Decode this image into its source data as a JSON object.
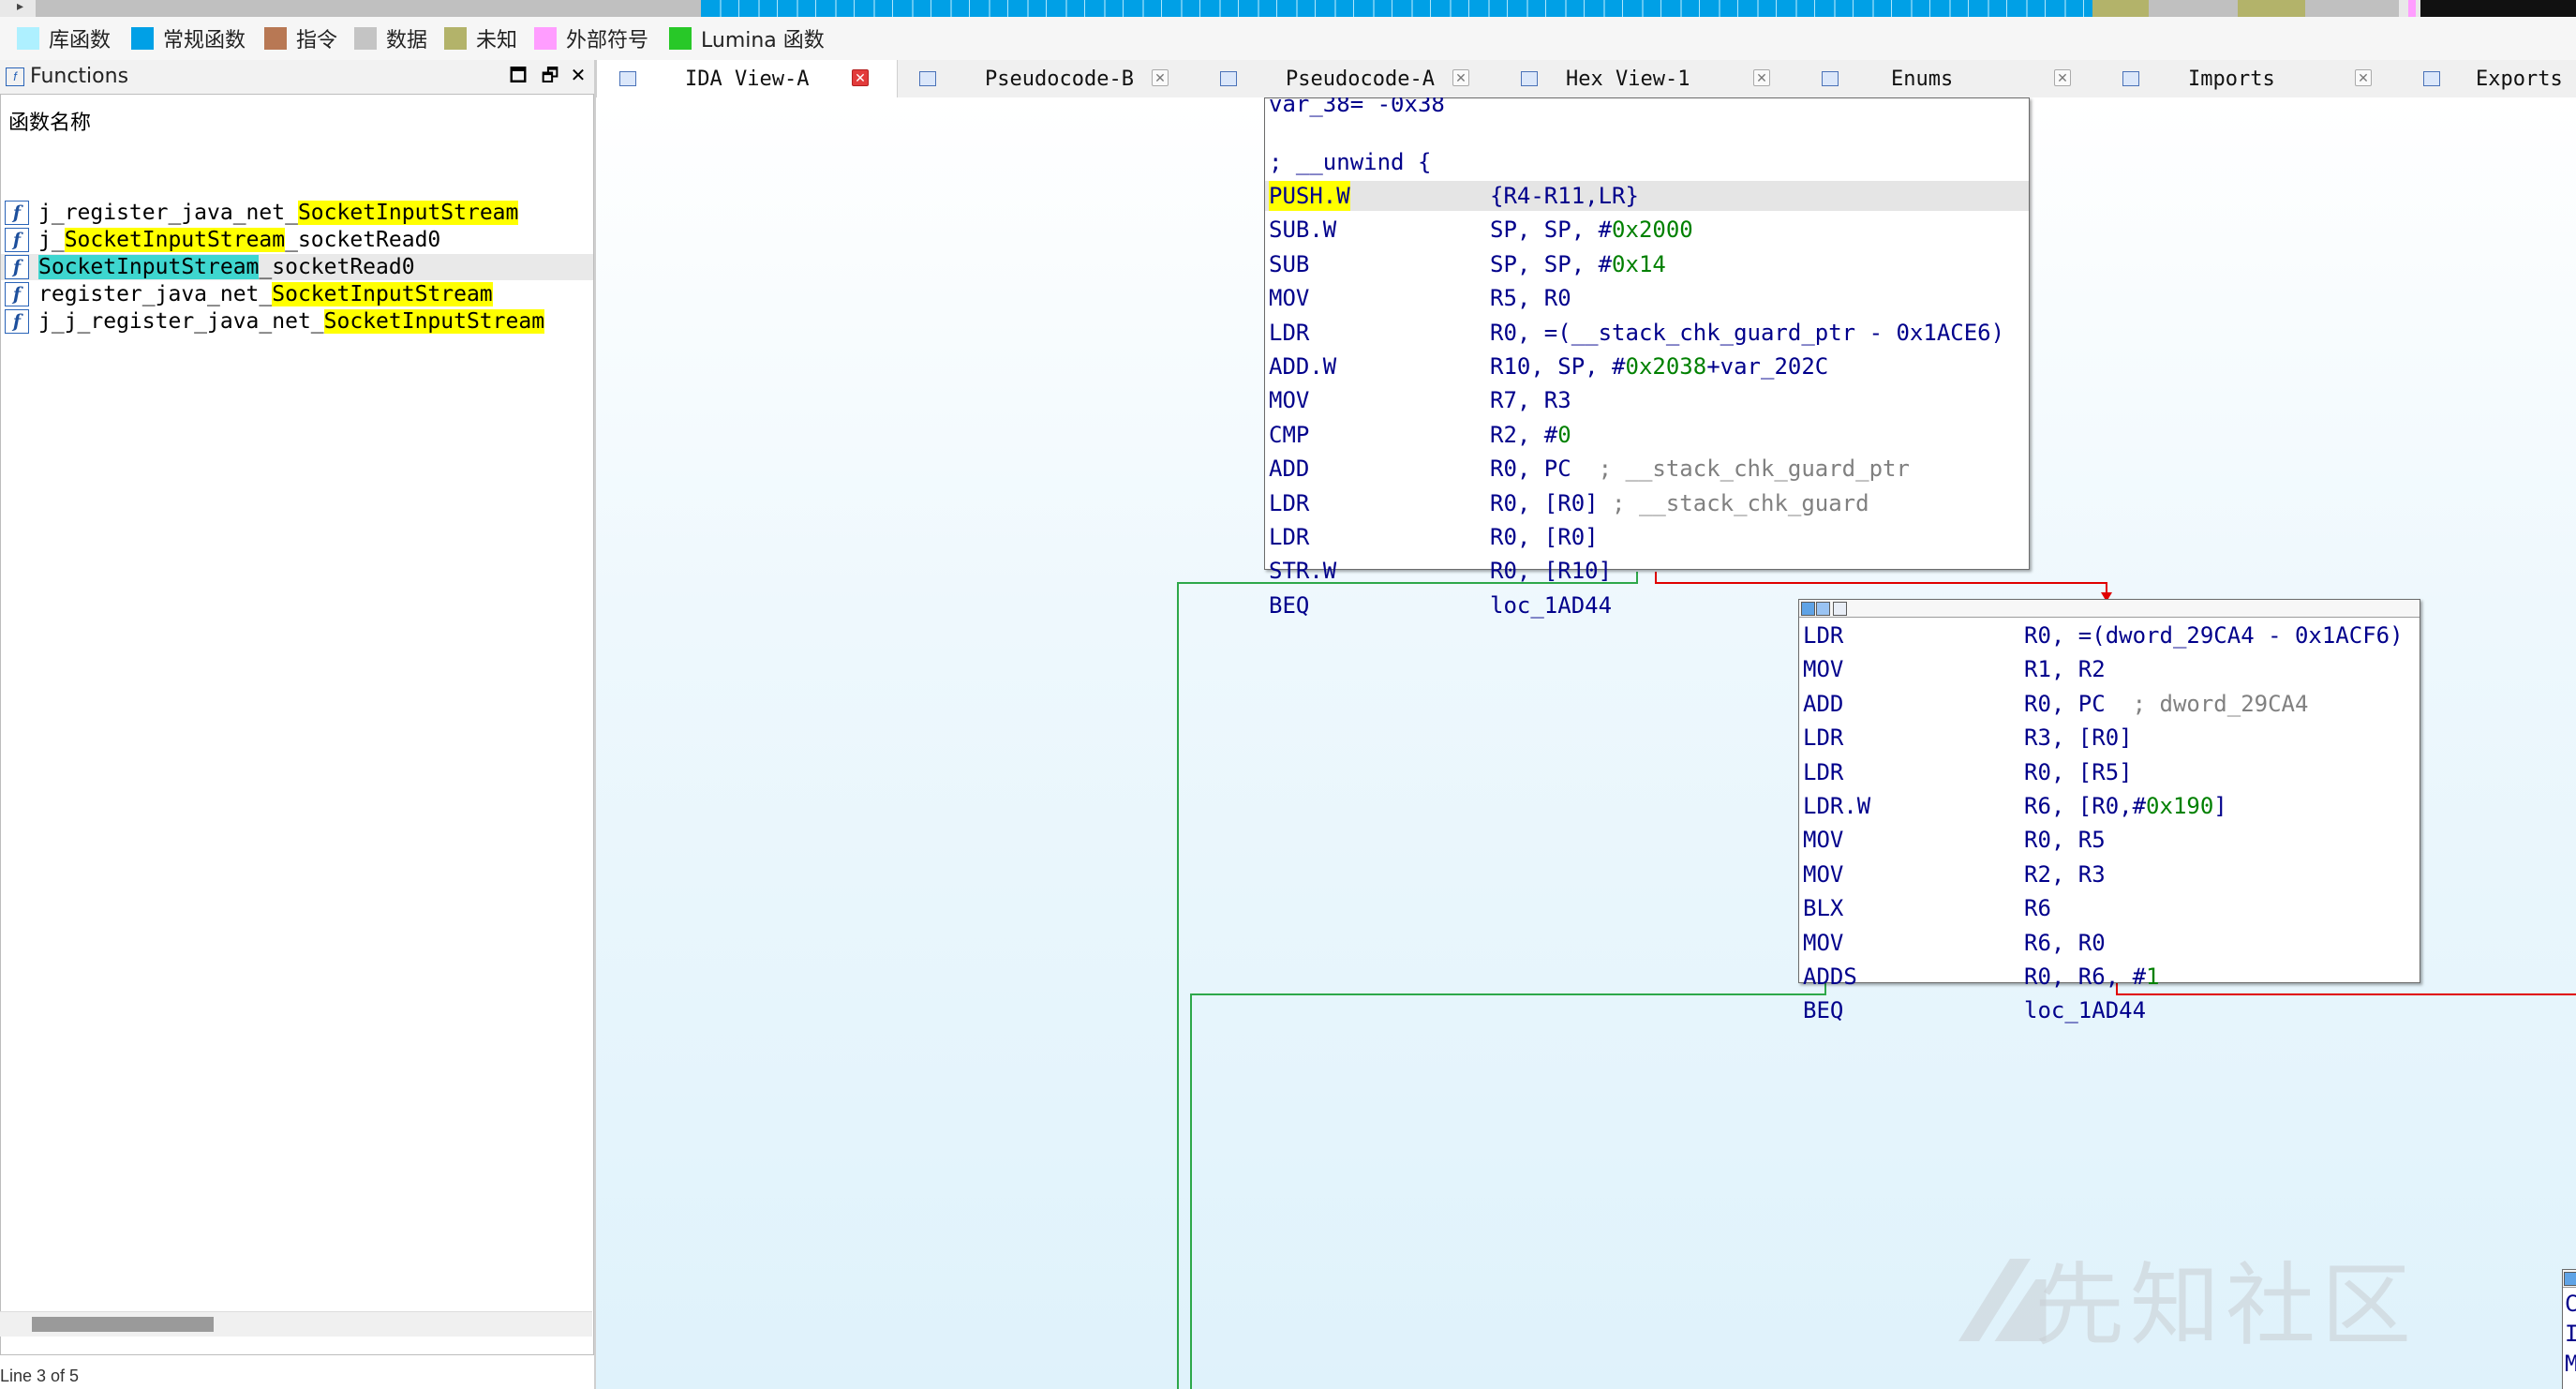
{
  "legend": {
    "items": [
      {
        "label": "库函数",
        "color": "#aef0ff"
      },
      {
        "label": "常规函数",
        "color": "#00a0e6"
      },
      {
        "label": "指令",
        "color": "#b87854"
      },
      {
        "label": "数据",
        "color": "#c4c4c4"
      },
      {
        "label": "未知",
        "color": "#b3b36a"
      },
      {
        "label": "外部符号",
        "color": "#ff9dff"
      },
      {
        "label": "Lumina 函数",
        "color": "#28c828"
      }
    ]
  },
  "functions_window": {
    "title": "Functions",
    "column_header": "函数名称",
    "rows": [
      {
        "prefix": "j_register_java_net_",
        "match": "SocketInputStream",
        "suffix": ""
      },
      {
        "prefix": "j_",
        "match": "SocketInputStream",
        "suffix": "_socketRead0"
      },
      {
        "prefix": "",
        "match": "SocketInputStream",
        "suffix": "_socketRead0"
      },
      {
        "prefix": "register_java_net_",
        "match": "SocketInputStream",
        "suffix": ""
      },
      {
        "prefix": "j_j_register_java_net_",
        "match": "SocketInputStream",
        "suffix": ""
      }
    ],
    "status_text": "Line 3 of 5"
  },
  "tabs": [
    {
      "label": "IDA View-A",
      "active": true
    },
    {
      "label": "Pseudocode-B",
      "active": false
    },
    {
      "label": "Pseudocode-A",
      "active": false
    },
    {
      "label": "Hex View-1",
      "active": false
    },
    {
      "label": "Enums",
      "active": false
    },
    {
      "label": "Imports",
      "active": false
    },
    {
      "label": "Exports",
      "active": false
    }
  ],
  "node1": {
    "top_line": "var_38= -0x38",
    "unwind": "; __unwind {",
    "rows": [
      {
        "mn": "PUSH.W",
        "ops": "{R4-R11,LR}"
      },
      {
        "mn": "SUB.W",
        "ops": "SP, SP, #0x2000"
      },
      {
        "mn": "SUB",
        "ops": "SP, SP, #0x14"
      },
      {
        "mn": "MOV",
        "ops": "R5, R0"
      },
      {
        "mn": "LDR",
        "ops": "R0, =(__stack_chk_guard_ptr - 0x1ACE6)"
      },
      {
        "mn": "ADD.W",
        "ops": "R10, SP, #0x2038+var_202C"
      },
      {
        "mn": "MOV",
        "ops": "R7, R3"
      },
      {
        "mn": "CMP",
        "ops": "R2, #0"
      },
      {
        "mn": "ADD",
        "ops": "R0, PC  ; __stack_chk_guard_ptr"
      },
      {
        "mn": "LDR",
        "ops": "R0, [R0] ; __stack_chk_guard"
      },
      {
        "mn": "LDR",
        "ops": "R0, [R0]"
      },
      {
        "mn": "STR.W",
        "ops": "R0, [R10]"
      },
      {
        "mn": "BEQ",
        "ops": "loc_1AD44"
      }
    ]
  },
  "node2": {
    "rows": [
      {
        "mn": "LDR",
        "ops": "R0, =(dword_29CA4 - 0x1ACF6)"
      },
      {
        "mn": "MOV",
        "ops": "R1, R2"
      },
      {
        "mn": "ADD",
        "ops": "R0, PC  ; dword_29CA4"
      },
      {
        "mn": "LDR",
        "ops": "R3, [R0]"
      },
      {
        "mn": "LDR",
        "ops": "R0, [R5]"
      },
      {
        "mn": "LDR.W",
        "ops": "R6, [R0,#0x190]"
      },
      {
        "mn": "MOV",
        "ops": "R0, R5"
      },
      {
        "mn": "MOV",
        "ops": "R2, R3"
      },
      {
        "mn": "BLX",
        "ops": "R6"
      },
      {
        "mn": "MOV",
        "ops": "R6, R0"
      },
      {
        "mn": "ADDS",
        "ops": "R0, R6, #1"
      },
      {
        "mn": "BEQ",
        "ops": "loc_1AD44"
      }
    ]
  },
  "node3_partial": [
    "C",
    "I",
    "M"
  ],
  "watermark": "先知社区"
}
